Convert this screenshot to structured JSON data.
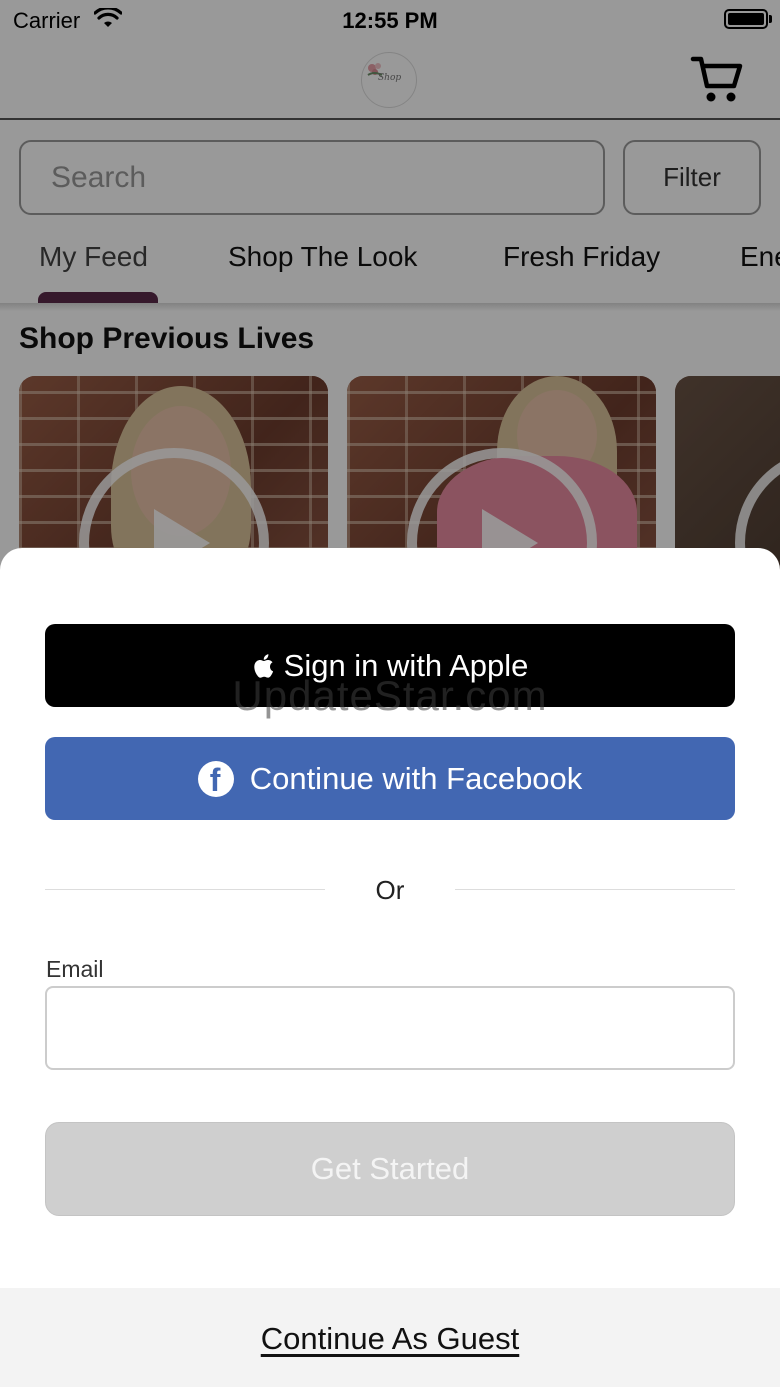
{
  "status_bar": {
    "carrier": "Carrier",
    "time": "12:55 PM"
  },
  "header": {
    "logo_text": "Shop"
  },
  "search": {
    "placeholder": "Search",
    "filter_label": "Filter"
  },
  "tabs": [
    {
      "label": "My Feed",
      "active": true
    },
    {
      "label": "Shop The Look",
      "active": false
    },
    {
      "label": "Fresh Friday",
      "active": false
    },
    {
      "label": "Ene",
      "active": false
    }
  ],
  "section": {
    "title": "Shop Previous Lives"
  },
  "sheet": {
    "apple_label": "Sign in with Apple",
    "watermark": "UpdateStar.com",
    "facebook_label": "Continue with Facebook",
    "or_label": "Or",
    "email_label": "Email",
    "email_value": "",
    "get_started_label": "Get Started",
    "guest_label": "Continue As Guest"
  },
  "colors": {
    "facebook": "#4267b2",
    "apple": "#000000",
    "tab_indicator": "#5a2a4a",
    "disabled_button": "#cfcfcf"
  },
  "icons": [
    "wifi-icon",
    "battery-icon",
    "cart-icon",
    "apple-icon",
    "facebook-icon",
    "play-icon"
  ]
}
